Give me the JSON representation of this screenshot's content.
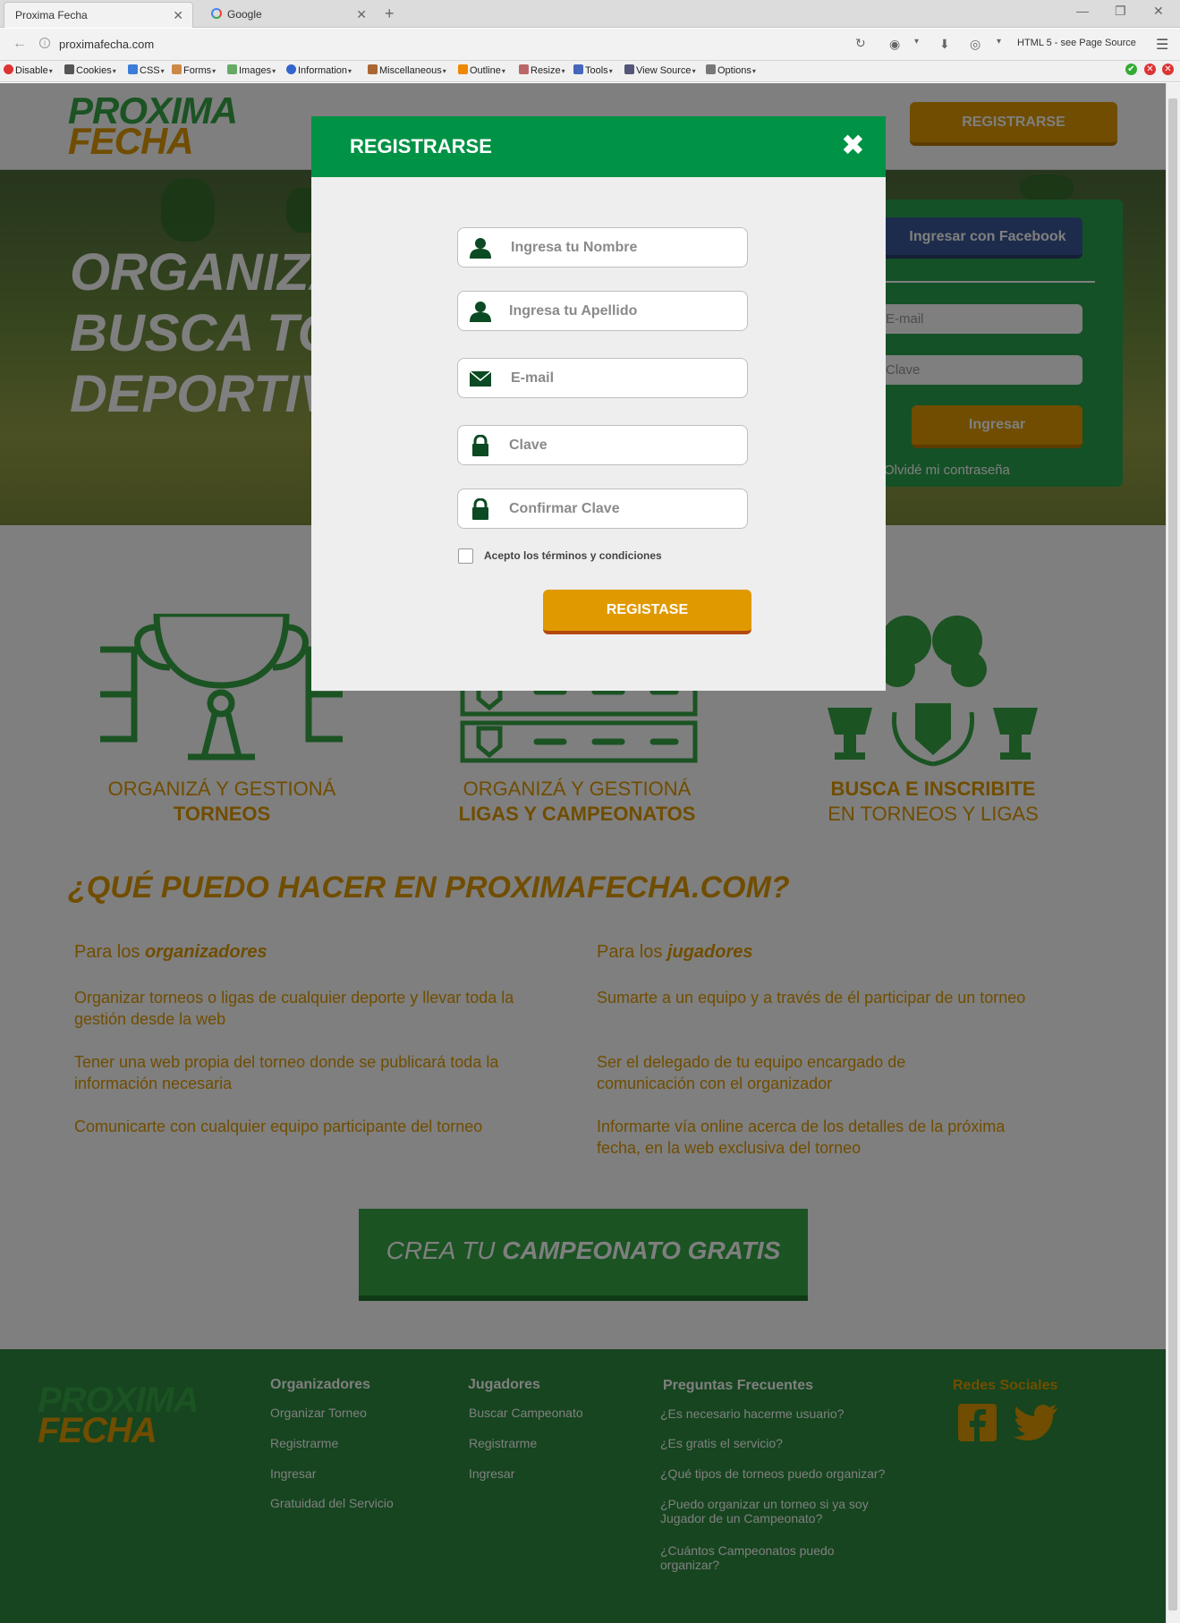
{
  "browser": {
    "tabs": [
      {
        "label": "Proxima Fecha",
        "active": true
      },
      {
        "label": "Google",
        "active": false
      }
    ],
    "url": "proximafecha.com",
    "page_source_label": "HTML 5 - see Page Source",
    "devtools": [
      "Disable",
      "Cookies",
      "CSS",
      "Forms",
      "Images",
      "Information",
      "Miscellaneous",
      "Outline",
      "Resize",
      "Tools",
      "View Source",
      "Options"
    ]
  },
  "header": {
    "logo_line1": "PROXIMA",
    "logo_line2": "FECHA",
    "register_button": "REGISTRARSE"
  },
  "hero": {
    "lines": [
      "ORGANIZA",
      "BUSCA TO",
      "DEPORTIV"
    ],
    "facebook_button": "Ingresar con Facebook",
    "email_placeholder": "E-mail",
    "password_placeholder": "Clave",
    "login_button": "Ingresar",
    "forgot_link": "Olvidé mi contraseña"
  },
  "features": [
    {
      "line1": "ORGANIZÁ Y GESTIONÁ",
      "line2": "TORNEOS",
      "icon": "trophy-bracket-icon"
    },
    {
      "line1": "ORGANIZÁ Y GESTIONÁ",
      "line2": "LIGAS Y CAMPEONATOS",
      "icon": "league-table-icon"
    },
    {
      "line1": "BUSCA E INSCRIBITE",
      "line2": "EN TORNEOS Y LIGAS",
      "icon": "binoculars-trophies-icon"
    }
  ],
  "question": {
    "title": "¿QUÉ PUEDO HACER EN PROXIMAFECHA.COM?",
    "organizers": {
      "prefix": "Para los",
      "emph": "organizadores",
      "items": [
        "Organizar torneos o ligas de cualquier deporte y llevar toda la gestión desde la web",
        "Tener una web propia del torneo donde se publicará toda la información necesaria",
        "Comunicarte con cualquier equipo participante del torneo"
      ]
    },
    "players": {
      "prefix": "Para los",
      "emph": "jugadores",
      "items": [
        "Sumarte a un equipo y a través de él participar de un torneo",
        "Ser el delegado de tu equipo encargado de comunicación con el organizador",
        "Informarte vía online acerca de los detalles de la próxima fecha, en la web exclusiva del torneo"
      ]
    }
  },
  "cta": {
    "prefix": "CREA TU",
    "emph": "CAMPEONATO GRATIS"
  },
  "footer": {
    "organizadores": {
      "title": "Organizadores",
      "links": [
        "Organizar Torneo",
        "Registrarme",
        "Ingresar",
        "Gratuidad del Servicio"
      ]
    },
    "jugadores": {
      "title": "Jugadores",
      "links": [
        "Buscar Campeonato",
        "Registrarme",
        "Ingresar"
      ]
    },
    "faq": {
      "title": "Preguntas Frecuentes",
      "links": [
        "¿Es necesario hacerme usuario?",
        "¿Es gratis el servicio?",
        "¿Qué tipos de torneos puedo organizar?",
        "¿Puedo organizar un torneo si ya soy Jugador de un Campeonato?",
        "¿Cuántos Campeonatos puedo organizar?"
      ]
    },
    "social": {
      "title": "Redes Sociales",
      "icons": [
        "facebook-icon",
        "twitter-icon"
      ]
    }
  },
  "modal": {
    "title": "REGISTRARSE",
    "fields": [
      {
        "placeholder": "Ingresa tu Nombre",
        "icon": "user-icon"
      },
      {
        "placeholder": "Ingresa tu Apellido",
        "icon": "user-icon"
      },
      {
        "placeholder": "E-mail",
        "icon": "envelope-icon"
      },
      {
        "placeholder": "Clave",
        "icon": "lock-icon"
      },
      {
        "placeholder": "Confirmar Clave",
        "icon": "lock-icon"
      }
    ],
    "terms": "Acepto los términos y condiciones",
    "terms_checked": false,
    "submit": "REGISTASE"
  },
  "colors": {
    "green": "#009245",
    "orange": "#e09a00",
    "dark_green_icon": "#0b4a22"
  }
}
